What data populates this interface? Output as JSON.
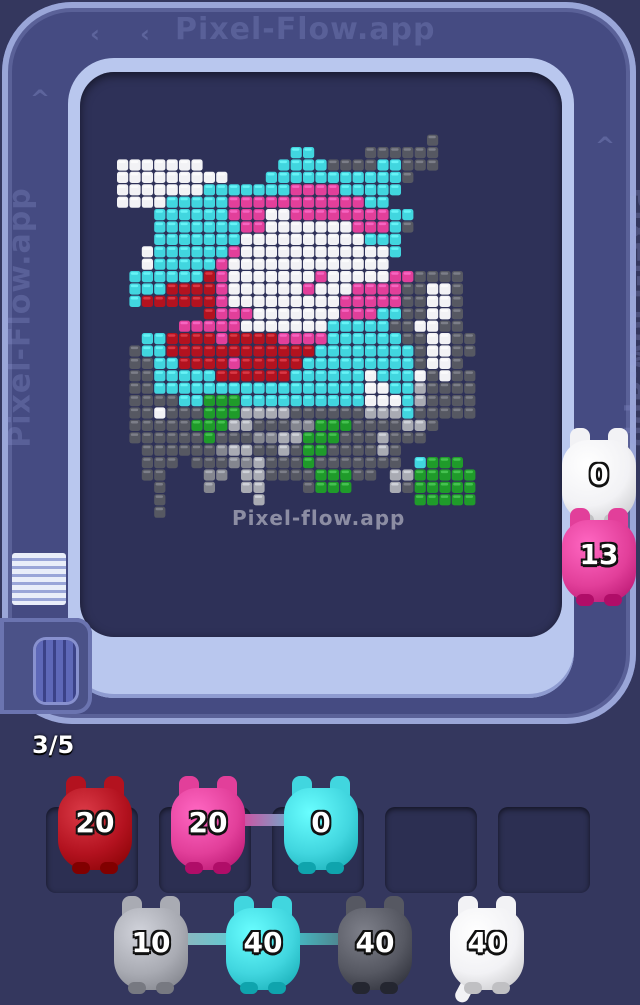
{
  "watermark": {
    "text": "Pixel-Flow.app",
    "center_text": "Pixel-flow.app"
  },
  "queue": {
    "progress_label": "3/5"
  },
  "colors": {
    "red": "#b3121f",
    "pink": "#e23f9a",
    "cyan": "#41d6df",
    "white": "#f2f2f5",
    "silver": "#a9abb3",
    "dark_gray": "#565862",
    "gray": "#84868f",
    "green": "#1f9b2a",
    "track": "#454b82",
    "board": "#2e3158"
  },
  "track_pigs": [
    {
      "id": "white",
      "count": "0",
      "color": "white"
    },
    {
      "id": "pink",
      "count": "13",
      "color": "pink"
    }
  ],
  "slots": [
    {
      "id": "slot-1",
      "pig": {
        "count": "20",
        "color": "red"
      }
    },
    {
      "id": "slot-2",
      "pig": {
        "count": "20",
        "color": "pink"
      }
    },
    {
      "id": "slot-3",
      "pig": {
        "count": "0",
        "color": "cyan"
      }
    },
    {
      "id": "slot-4",
      "pig": null
    },
    {
      "id": "slot-5",
      "pig": null
    }
  ],
  "waiting_pigs": [
    {
      "count": "10",
      "color": "silver"
    },
    {
      "count": "40",
      "color": "cyan"
    },
    {
      "count": "40",
      "color": "dark_gray"
    },
    {
      "count": "40",
      "color": "white"
    }
  ],
  "pixel_art": {
    "legend": {
      "W": "white",
      "C": "cyan",
      "P": "pink",
      "R": "red",
      "G": "gray",
      "D": "dark_gray",
      "S": "silver",
      "N": "green"
    },
    "rows": [
      "..........................D....",
      "...............CC....DDDDDD...",
      ".WWWWWWW......CCCCDDDDCCDDD...",
      ".WWWWWWWWW...CCCCCCCCCCCD.....",
      ".WWWWWWWCCCCCCCPPPPCCCCC......",
      ".WWWWCCCCCPPPPPPPPPPPCC.......",
      "....CCCCCCPPPWWPPPPPPPPCC.....",
      "....CCCCCCCPPWWWWWWWPPPCD.....",
      "....CCCCCCCWWWWWWWWWWCCC......",
      "...WCCCCCCPWWWWWWWWWWWWC......",
      "...WCCCCCPWWWWWWWWWWWWW.......",
      "..CCCCCCRPWWWWWWWPWWWWWPPDDDD.",
      "..CCCRRRRPWWWWWWPWWWPPPPDDWWD.",
      "..CRRRRRRPWWWWWWWWWPPPPPDDWWD.",
      "........RPPPWWWWWWWPPPCCDDWWD.",
      "......PPPPPWWWWWWWCCCCCDDWWDD.",
      "...CCRRRRPRRRRPPPPCCCCCCDDWWDD",
      "..DCCRRRRRRRRRRRRCCCCCCCCDWWDD",
      "..DDCCRRRRPRRRRRCCCCCCCCCDWWD.",
      "..DDCCCCCRRRRRRCCCCCCWCCCWDWDD",
      "..DDCCCCCCCCCCCCCCCCCWWCCSDDDD",
      "..DDDDCCNNNCCCCCCCCCCWWWCSDDDD",
      "..DDWDDDNNNSSSSDDDDDDSSSCDDDDD",
      "..DDDDDNNNSSDDDGGNNNDDDDSSD...",
      "..DDDDDDNDDDGGSSNNNDDDSDDD....",
      "...DDDDDDGSSDDSDNNDDDDSD......",
      "...DDD.DDDGGSDDDNDDDDDDD.CNNN..",
      "...DD...GG.SSDDDDNNNDD.SSNNNNN.",
      "....D...G..SS...DNNN...SDNNNNN.",
      "....D.......S.......... .NNNNN.",
      "....D..........................."
    ]
  }
}
